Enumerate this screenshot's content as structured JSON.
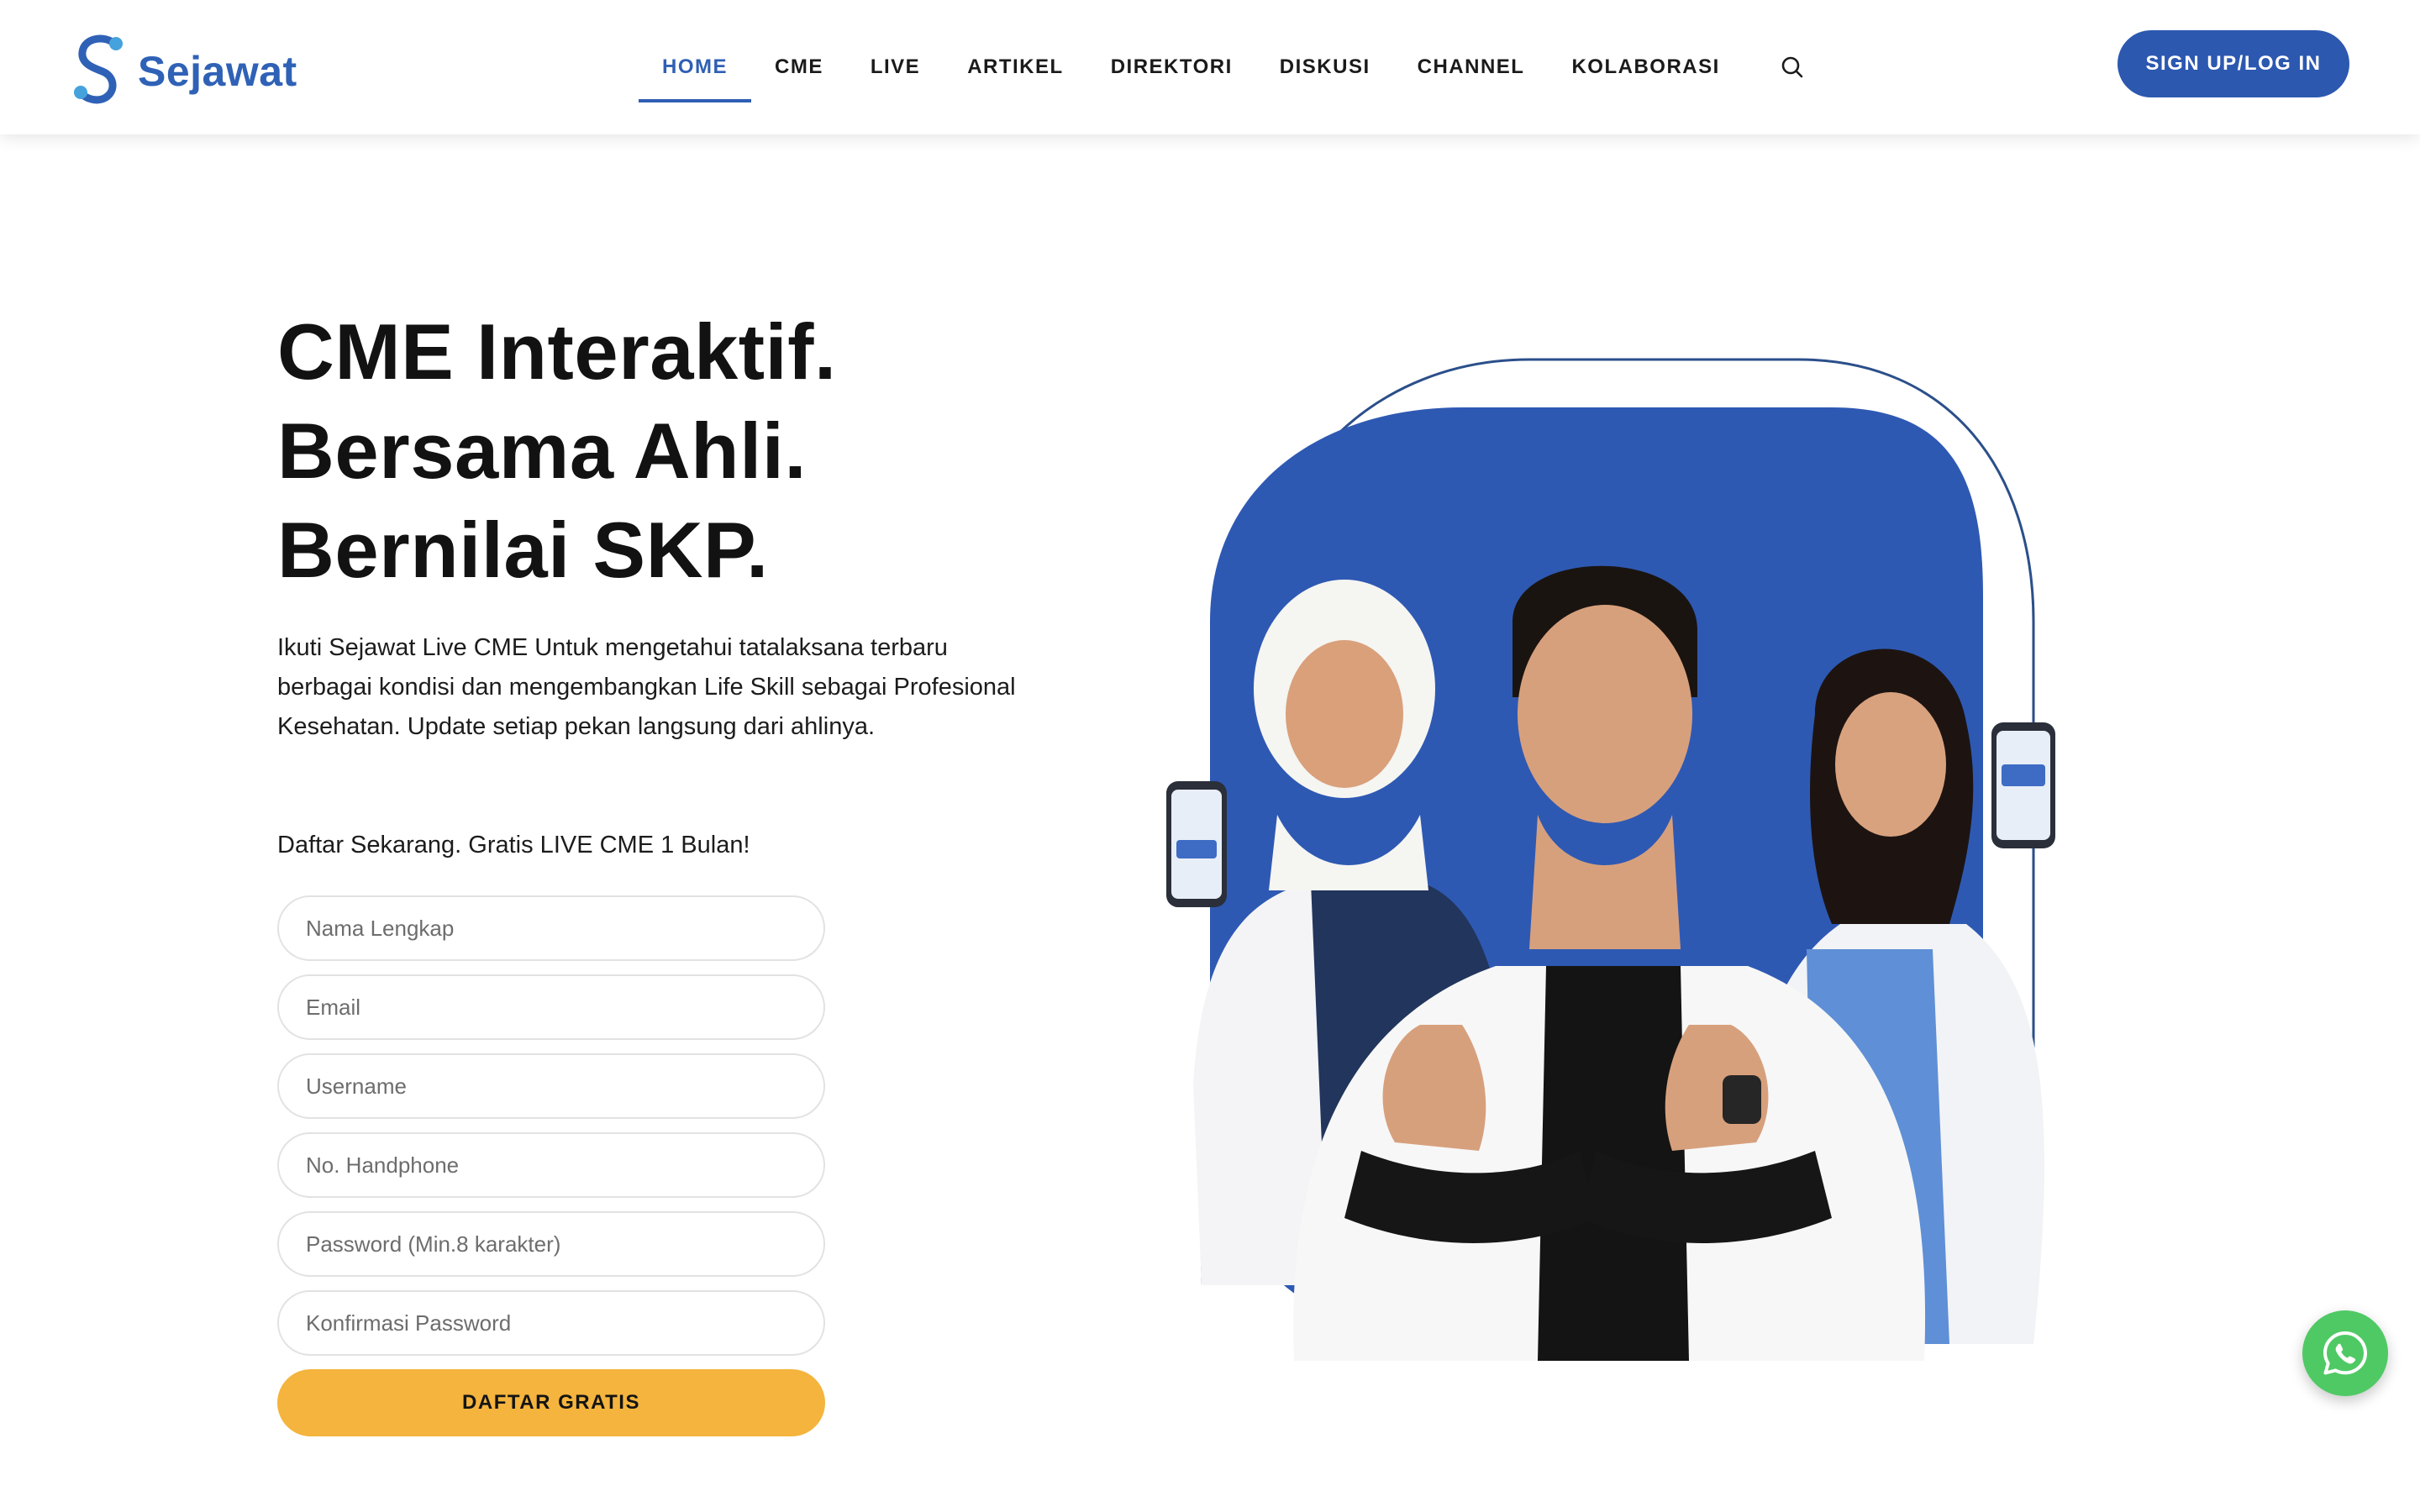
{
  "header": {
    "logo_text": "Sejawat",
    "nav": [
      {
        "label": "HOME",
        "active": true
      },
      {
        "label": "CME",
        "active": false
      },
      {
        "label": "LIVE",
        "active": false
      },
      {
        "label": "ARTIKEL",
        "active": false
      },
      {
        "label": "DIREKTORI",
        "active": false
      },
      {
        "label": "DISKUSI",
        "active": false
      },
      {
        "label": "CHANNEL",
        "active": false
      },
      {
        "label": "KOLABORASI",
        "active": false
      }
    ],
    "search_icon": "search-icon",
    "signup_label": "SIGN UP/LOG IN"
  },
  "hero": {
    "title_lines": [
      "CME Interaktif.",
      "Bersama Ahli.",
      "Bernilai SKP."
    ],
    "description": "Ikuti Sejawat Live CME Untuk mengetahui tatalaksana terbaru berbagai kondisi dan mengembangkan Life Skill sebagai Profesional Kesehatan. Update setiap pekan langsung dari ahlinya.",
    "cta_text": "Daftar Sekarang. Gratis LIVE CME 1 Bulan!"
  },
  "form": {
    "fields": [
      {
        "placeholder": "Nama Lengkap",
        "value": ""
      },
      {
        "placeholder": "Email",
        "value": ""
      },
      {
        "placeholder": "Username",
        "value": ""
      },
      {
        "placeholder": "No. Handphone",
        "value": ""
      },
      {
        "placeholder": "Password (Min.8 karakter)",
        "value": ""
      },
      {
        "placeholder": "Konfirmasi Password",
        "value": ""
      }
    ],
    "submit_label": "DAFTAR GRATIS"
  },
  "floating": {
    "whatsapp_icon": "whatsapp-icon"
  },
  "colors": {
    "brand_blue": "#2c58b0",
    "nav_active": "#2f5fb3",
    "cta_yellow": "#f4b43d",
    "whatsapp_green": "#4fc964"
  }
}
